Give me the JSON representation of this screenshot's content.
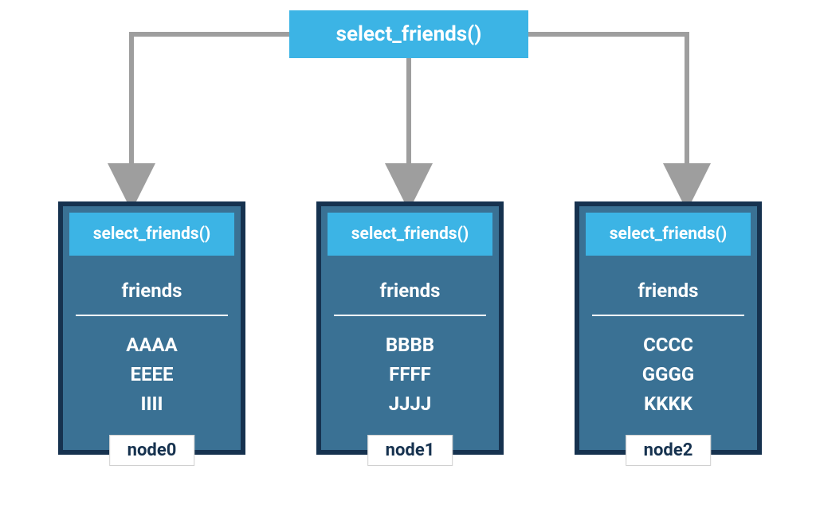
{
  "root": {
    "label": "select_friends()"
  },
  "colors": {
    "lightBlue": "#3cb4e5",
    "midBlue": "#3a7194",
    "darkBlue": "#16324f",
    "arrowGray": "#9e9e9e"
  },
  "nodes": [
    {
      "header": "select_friends()",
      "section": "friends",
      "data": [
        "AAAA",
        "EEEE",
        "IIII"
      ],
      "label": "node0"
    },
    {
      "header": "select_friends()",
      "section": "friends",
      "data": [
        "BBBB",
        "FFFF",
        "JJJJ"
      ],
      "label": "node1"
    },
    {
      "header": "select_friends()",
      "section": "friends",
      "data": [
        "CCCC",
        "GGGG",
        "KKKK"
      ],
      "label": "node2"
    }
  ]
}
